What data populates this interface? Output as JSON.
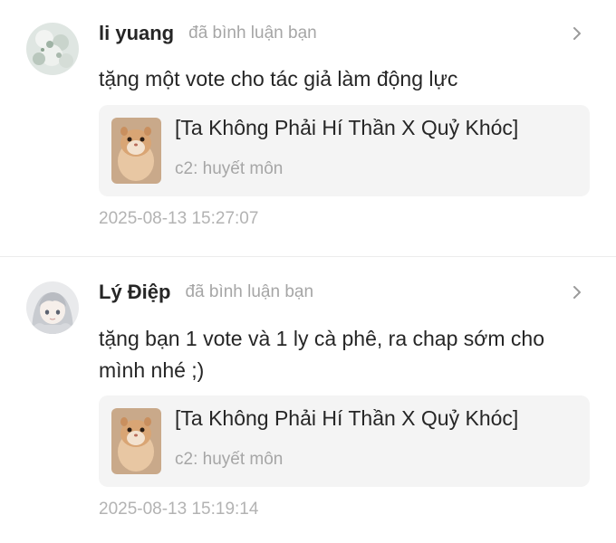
{
  "notifications": [
    {
      "user": "li yuang",
      "action": "đã bình luận bạn",
      "comment": "tặng một vote cho tác giả làm động lực",
      "work": {
        "title": "[Ta Không Phải Hí Thần X Quỷ Khóc]",
        "chapter": "c2: huyết môn"
      },
      "time": "2025-08-13 15:27:07",
      "avatar_icon": "flower-avatar",
      "chevron_icon": "chevron-right-icon"
    },
    {
      "user": "Lý Điệp",
      "action": "đã bình luận bạn",
      "comment": "tặng bạn 1 vote và 1 ly cà phê, ra chap sớm cho mình nhé ;)",
      "work": {
        "title": "[Ta Không Phải Hí Thần X Quỷ Khóc]",
        "chapter": "c2: huyết môn"
      },
      "time": "2025-08-13 15:19:14",
      "avatar_icon": "anime-girl-avatar",
      "chevron_icon": "chevron-right-icon"
    }
  ],
  "colors": {
    "name": "#262626",
    "muted": "#a6a6a6",
    "card_bg": "#f4f4f4",
    "divider": "#ececec"
  }
}
